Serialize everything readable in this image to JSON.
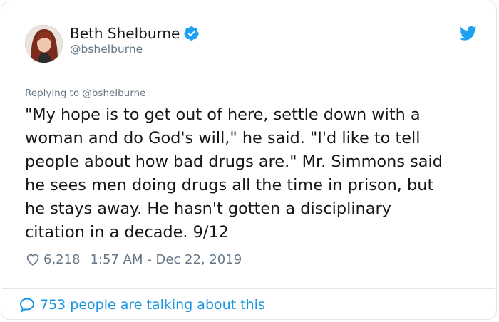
{
  "author": {
    "name": "Beth Shelburne",
    "handle": "@bshelburne",
    "verified": true
  },
  "reply_context": "Replying to @bshelburne",
  "tweet": {
    "lines": [
      "\"My hope is to get out of here, settle down with a",
      "woman and do God's will,\" he said. \"I'd like to tell",
      "people about how bad drugs are.\" Mr. Simmons said",
      "he sees men doing drugs all the time in prison, but",
      "he stays away. He hasn't gotten a disciplinary",
      "citation in a decade. 9/12"
    ],
    "like_count": "6,218",
    "timestamp": "1:57 AM - Dec 22, 2019"
  },
  "footer": {
    "talking_text": "753 people are talking about this"
  },
  "icons": {
    "verified": "verified-badge-icon",
    "platform": "bird-logo-icon",
    "like": "heart-icon",
    "conversation": "speech-bubble-icon"
  },
  "colors": {
    "accent": "#1da1f2",
    "link": "#1b95e0",
    "muted": "#657786",
    "text": "#14171a",
    "border": "#e1e8ed"
  }
}
